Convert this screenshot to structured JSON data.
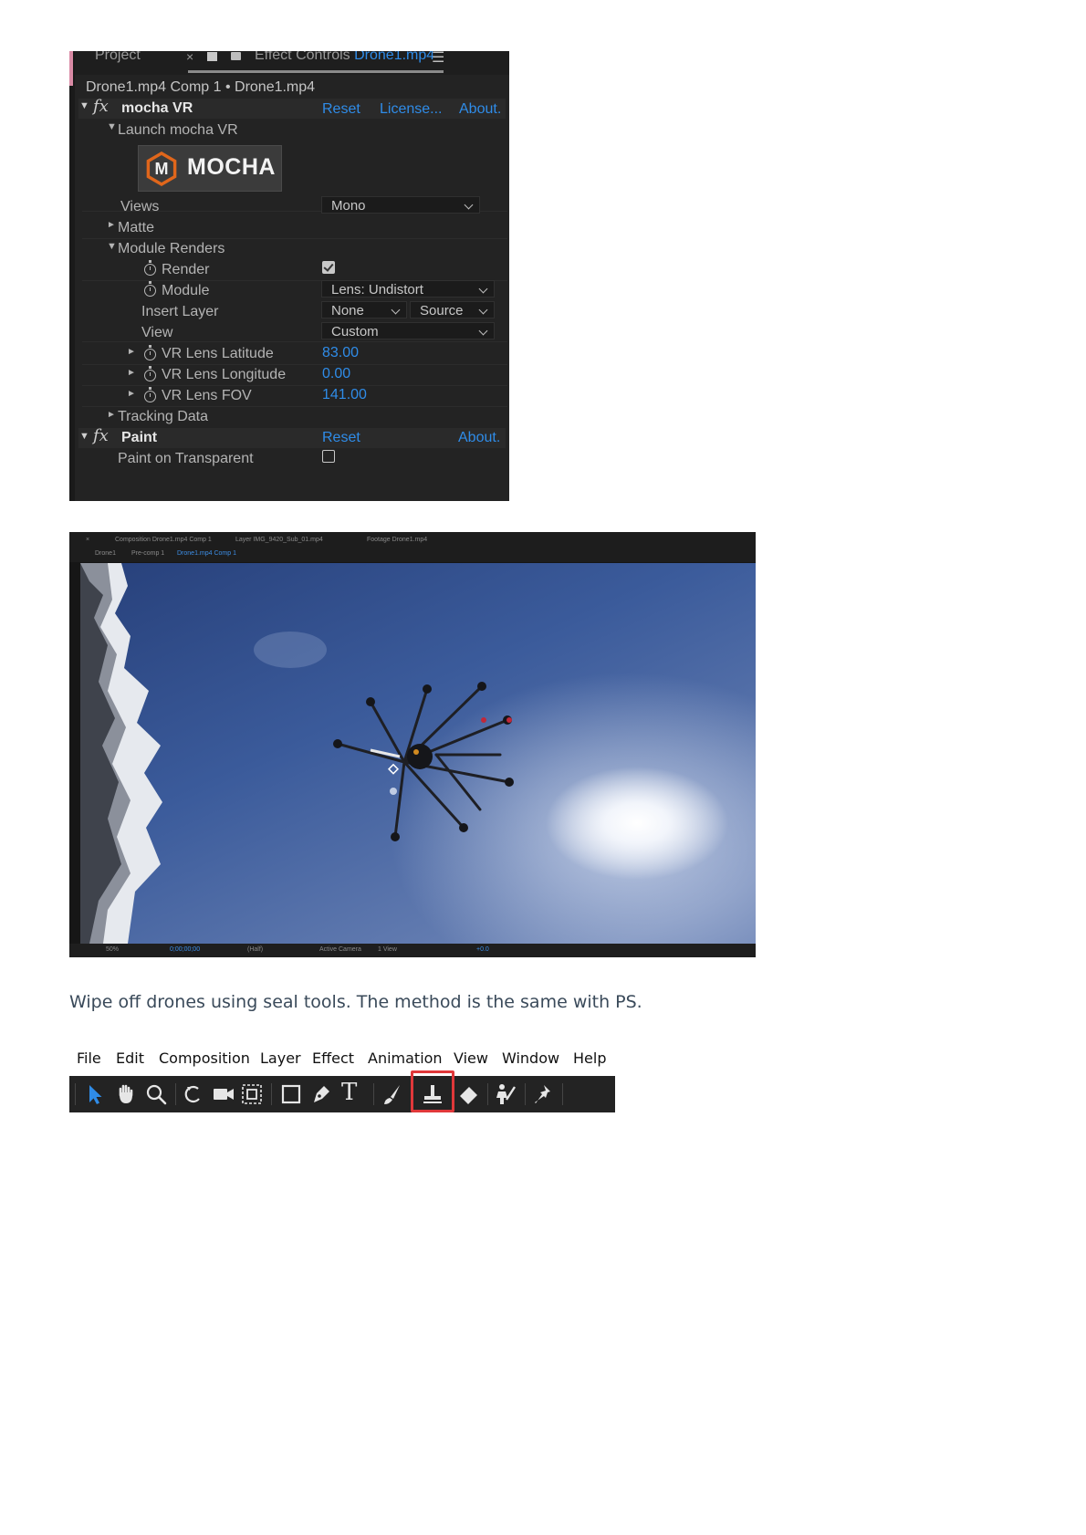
{
  "effect_controls": {
    "tabs": {
      "project": "Project",
      "close": "×",
      "effect_controls": "Effect Controls",
      "layer": "Drone1.mp4",
      "menu": "☰"
    },
    "breadcrumb": "Drone1.mp4 Comp 1 • Drone1.mp4",
    "mocha_effect": {
      "fx": "fx",
      "name": "mocha VR",
      "reset": "Reset",
      "license": "License...",
      "about": "About.",
      "launch_label": "Launch mocha VR",
      "logo_letter": "M",
      "logo_text": "MOCHA",
      "views_label": "Views",
      "views_value": "Mono",
      "matte_label": "Matte",
      "module_renders_label": "Module Renders",
      "render_label": "Render",
      "render_checked": true,
      "module_label": "Module",
      "module_value": "Lens: Undistort",
      "insert_layer_label": "Insert Layer",
      "insert_layer_value": "None",
      "insert_layer_source": "Source",
      "view_label": "View",
      "view_value": "Custom",
      "lat_label": "VR Lens Latitude",
      "lat_value": "83.00",
      "lon_label": "VR Lens Longitude",
      "lon_value": "0.00",
      "fov_label": "VR Lens FOV",
      "fov_value": "141.00",
      "tracking_label": "Tracking Data"
    },
    "paint_effect": {
      "fx": "fx",
      "name": "Paint",
      "reset": "Reset",
      "about": "About.",
      "transparent_label": "Paint on Transparent",
      "transparent_checked": false
    },
    "triangles": {
      "down": "▼",
      "right": "►"
    }
  },
  "composition": {
    "tab_comp": "Composition Drone1.mp4 Comp 1",
    "tab_layer": "Layer IMG_9420_Sub_01.mp4",
    "tab_footage": "Footage Drone1.mp4",
    "crumb_1": "Drone1",
    "crumb_2": "Pre-comp 1",
    "crumb_3": "Drone1.mp4 Comp 1",
    "zoom": "50%",
    "timecode": "0;00;00;00",
    "resolution": "(Half)",
    "camera": "Active Camera",
    "views": "1 View",
    "exposure": "+0.0"
  },
  "caption": "Wipe off drones using seal tools. The method is the same with PS.",
  "menu": {
    "file": "File",
    "edit": "Edit",
    "composition": "Composition",
    "layer": "Layer",
    "effect": "Effect",
    "animation": "Animation",
    "view": "View",
    "window": "Window",
    "help": "Help"
  },
  "toolbar": {
    "highlight_color": "#e0383a",
    "accent": "#2f8ce8",
    "text_tool": "T",
    "tools": [
      "selection-icon",
      "hand-icon",
      "zoom-icon",
      "rotate-icon",
      "camera-icon",
      "pan-behind-icon",
      "rectangle-icon",
      "pen-icon",
      "type-icon",
      "brush-icon",
      "clone-stamp-icon",
      "eraser-icon",
      "roto-brush-icon",
      "puppet-pin-icon"
    ],
    "selected": "clone-stamp-icon"
  }
}
